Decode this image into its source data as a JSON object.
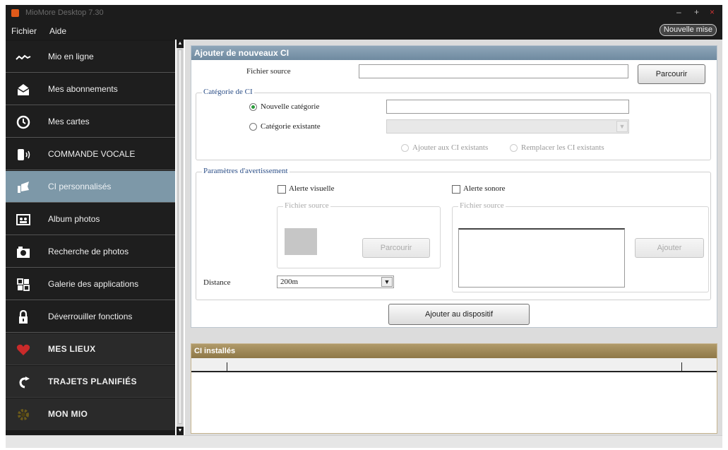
{
  "window": {
    "title": "MioMore Desktop 7.30",
    "controls": [
      "–",
      "+",
      "×"
    ]
  },
  "menubar": {
    "items": [
      "Fichier",
      "Aide"
    ],
    "new_map_button": "Nouvelle mise"
  },
  "sidebar": {
    "items": [
      {
        "label": "Mio en ligne",
        "icon": "signal-icon"
      },
      {
        "label": "Mes abonnements",
        "icon": "envelope-icon"
      },
      {
        "label": "Mes cartes",
        "icon": "compass-icon"
      },
      {
        "label": "COMMANDE VOCALE",
        "icon": "voice-icon"
      },
      {
        "label": "CI personnalisés",
        "icon": "flag-icon",
        "active": true
      },
      {
        "label": "Album photos",
        "icon": "photo-album-icon"
      },
      {
        "label": "Recherche de photos",
        "icon": "camera-icon"
      },
      {
        "label": "Galerie des applications",
        "icon": "app-grid-icon"
      },
      {
        "label": "Déverrouiller fonctions",
        "icon": "lock-icon"
      },
      {
        "label": "MES LIEUX",
        "icon": "heart-icon"
      },
      {
        "label": "TRAJETS PLANIFIÉS",
        "icon": "route-icon"
      },
      {
        "label": "MON MIO",
        "icon": "gear-icon"
      }
    ]
  },
  "panel": {
    "title": "Ajouter de nouveaux CI",
    "source_file_label": "Fichier source",
    "source_file_value": "",
    "browse_label": "Parcourir",
    "category_group": {
      "legend": "Catégorie de CI",
      "new_category_label": "Nouvelle catégorie",
      "new_category_value": "",
      "existing_category_label": "Catégorie existante",
      "existing_category_value": "",
      "add_to_existing_label": "Ajouter aux CI existants",
      "replace_existing_label": "Remplacer les CI existants"
    },
    "alert_group": {
      "legend": "Paramètres d'avertissement",
      "visual_alert_label": "Alerte visuelle",
      "sound_alert_label": "Alerte sonore",
      "visual_source_legend": "Fichier source",
      "visual_browse_label": "Parcourir",
      "sound_source_legend": "Fichier source",
      "sound_add_label": "Ajouter",
      "distance_label": "Distance",
      "distance_value": "200m"
    },
    "add_to_device_label": "Ajouter au dispositif"
  },
  "installed": {
    "title": "CI installés"
  },
  "colors": {
    "sidebar_bg": "#1e1e1e",
    "active_item": "#7d98a8",
    "panel_header": "#7a94a8",
    "installed_header": "#9e8858",
    "brand": "#e05a1a"
  }
}
